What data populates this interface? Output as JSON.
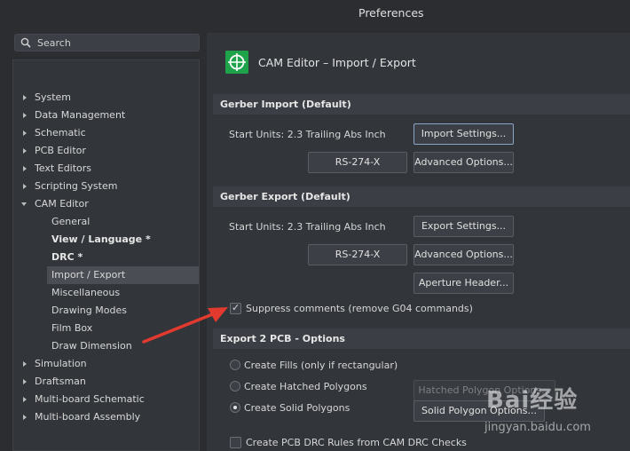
{
  "window": {
    "title": "Preferences"
  },
  "search": {
    "label": "Search"
  },
  "tree": [
    {
      "label": "System",
      "level": 0,
      "expanded": false,
      "bold": false,
      "selected": false
    },
    {
      "label": "Data Management",
      "level": 0,
      "expanded": false,
      "bold": false,
      "selected": false
    },
    {
      "label": "Schematic",
      "level": 0,
      "expanded": false,
      "bold": false,
      "selected": false
    },
    {
      "label": "PCB Editor",
      "level": 0,
      "expanded": false,
      "bold": false,
      "selected": false
    },
    {
      "label": "Text Editors",
      "level": 0,
      "expanded": false,
      "bold": false,
      "selected": false
    },
    {
      "label": "Scripting System",
      "level": 0,
      "expanded": false,
      "bold": false,
      "selected": false
    },
    {
      "label": "CAM Editor",
      "level": 0,
      "expanded": true,
      "bold": false,
      "selected": false
    },
    {
      "label": "General",
      "level": 1,
      "bold": false,
      "selected": false
    },
    {
      "label": "View / Language *",
      "level": 1,
      "bold": true,
      "selected": false
    },
    {
      "label": "DRC *",
      "level": 1,
      "bold": true,
      "selected": false
    },
    {
      "label": "Import / Export",
      "level": 1,
      "bold": false,
      "selected": true
    },
    {
      "label": "Miscellaneous",
      "level": 1,
      "bold": false,
      "selected": false
    },
    {
      "label": "Drawing Modes",
      "level": 1,
      "bold": false,
      "selected": false
    },
    {
      "label": "Film Box",
      "level": 1,
      "bold": false,
      "selected": false
    },
    {
      "label": "Draw Dimension",
      "level": 1,
      "bold": false,
      "selected": false
    },
    {
      "label": "Simulation",
      "level": 0,
      "expanded": false,
      "bold": false,
      "selected": false
    },
    {
      "label": "Draftsman",
      "level": 0,
      "expanded": false,
      "bold": false,
      "selected": false
    },
    {
      "label": "Multi-board Schematic",
      "level": 0,
      "expanded": false,
      "bold": false,
      "selected": false
    },
    {
      "label": "Multi-board Assembly",
      "level": 0,
      "expanded": false,
      "bold": false,
      "selected": false
    }
  ],
  "page": {
    "title": "CAM Editor – Import / Export",
    "gerber_import": {
      "heading": "Gerber Import (Default)",
      "start_units": "Start Units: 2.3 Trailing Abs Inch",
      "import_settings": "Import Settings...",
      "format": "RS-274-X",
      "advanced": "Advanced Options..."
    },
    "gerber_export": {
      "heading": "Gerber Export (Default)",
      "start_units": "Start Units: 2.3 Trailing Abs Inch",
      "export_settings": "Export Settings...",
      "format": "RS-274-X",
      "advanced": "Advanced Options...",
      "aperture": "Aperture Header...",
      "suppress_comments": "Suppress comments (remove G04 commands)",
      "suppress_checked": true
    },
    "export2pcb": {
      "heading": "Export 2 PCB - Options",
      "fills": "Create Fills (only if rectangular)",
      "hatched": "Create Hatched Polygons",
      "solid": "Create Solid Polygons",
      "selected": "solid",
      "hatched_options": "Hatched Polygon Options...",
      "solid_options": "Solid Polygon Options...",
      "drc_rules": "Create PCB DRC Rules from CAM DRC Checks",
      "drc_checked": false
    }
  },
  "watermark": {
    "brand": "Bai经验",
    "url": "jingyan.baidu.com"
  },
  "colors": {
    "accent_icon": "#1fa34a",
    "annotation_arrow": "#e23a2e"
  }
}
